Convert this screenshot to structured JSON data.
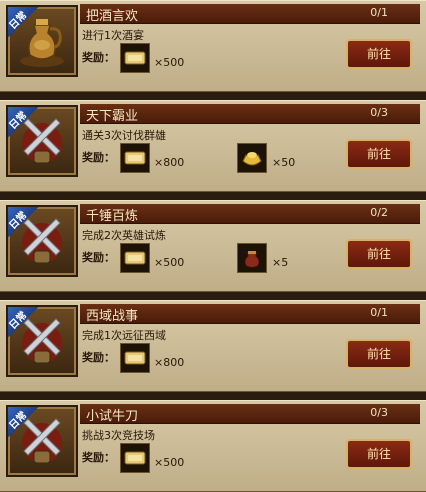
{
  "quests": [
    {
      "badge": "日常",
      "title": "把酒言欢",
      "progress": "0/1",
      "description": "进行1次酒宴",
      "reward_label": "奖励：",
      "icon": "wine-jug-icon",
      "rewards": [
        {
          "icon": "ticket-icon",
          "quantity": "×500"
        }
      ],
      "button_label": "前往"
    },
    {
      "badge": "日常",
      "title": "天下霸业",
      "progress": "0/3",
      "description": "通关3次讨伐群雄",
      "reward_label": "奖励：",
      "icon": "crossed-swords-icon",
      "rewards": [
        {
          "icon": "ticket-icon",
          "quantity": "×800"
        },
        {
          "icon": "gold-ingot-icon",
          "quantity": "×50"
        }
      ],
      "button_label": "前往"
    },
    {
      "badge": "日常",
      "title": "千锤百炼",
      "progress": "0/2",
      "description": "完成2次英雄试炼",
      "reward_label": "奖励：",
      "icon": "crossed-swords-icon",
      "rewards": [
        {
          "icon": "ticket-icon",
          "quantity": "×500"
        },
        {
          "icon": "pouch-icon",
          "quantity": "×5"
        }
      ],
      "button_label": "前往"
    },
    {
      "badge": "日常",
      "title": "西域战事",
      "progress": "0/1",
      "description": "完成1次远征西域",
      "reward_label": "奖励：",
      "icon": "crossed-swords-icon",
      "rewards": [
        {
          "icon": "ticket-icon",
          "quantity": "×800"
        }
      ],
      "button_label": "前往"
    },
    {
      "badge": "日常",
      "title": "小试牛刀",
      "progress": "0/3",
      "description": "挑战3次竞技场",
      "reward_label": "奖励：",
      "icon": "crossed-swords-icon",
      "rewards": [
        {
          "icon": "ticket-icon",
          "quantity": "×500"
        }
      ],
      "button_label": "前往"
    }
  ]
}
